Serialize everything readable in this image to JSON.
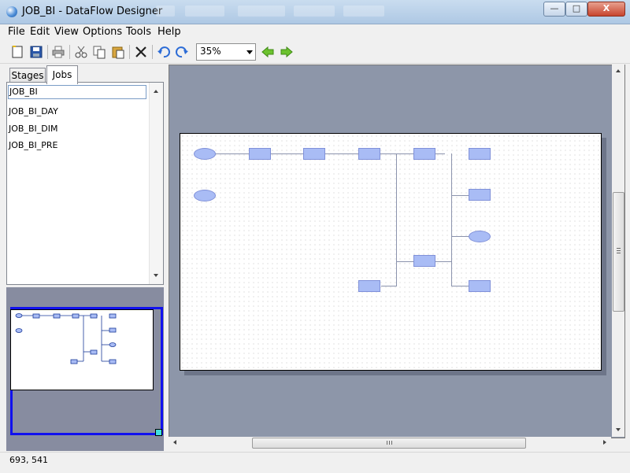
{
  "window": {
    "title": "JOB_BI - DataFlow Designer",
    "controls": {
      "minimize": "—",
      "maximize": "□",
      "close": "X"
    }
  },
  "menu": [
    "File",
    "Edit",
    "View",
    "Options",
    "Tools",
    "Help"
  ],
  "toolbar": {
    "icons": [
      "new-icon",
      "save-icon",
      "print-icon",
      "cut-icon",
      "copy-icon",
      "paste-icon",
      "delete-icon",
      "undo-icon",
      "redo-icon",
      "back-arrow-icon",
      "forward-arrow-icon"
    ],
    "zoom": "35%"
  },
  "tabs": [
    "Stages",
    "Jobs"
  ],
  "active_tab": "Jobs",
  "jobs": [
    "JOB_BI",
    "JOB_BI_DAY",
    "JOB_BI_DIM",
    "JOB_BI_PRE"
  ],
  "colors": {
    "node_fill": "#a9bcf5",
    "node_border": "#8091d9",
    "canvas_bg": "#8d96a9",
    "overview_frame": "#1111ee"
  },
  "status": "693, 541"
}
